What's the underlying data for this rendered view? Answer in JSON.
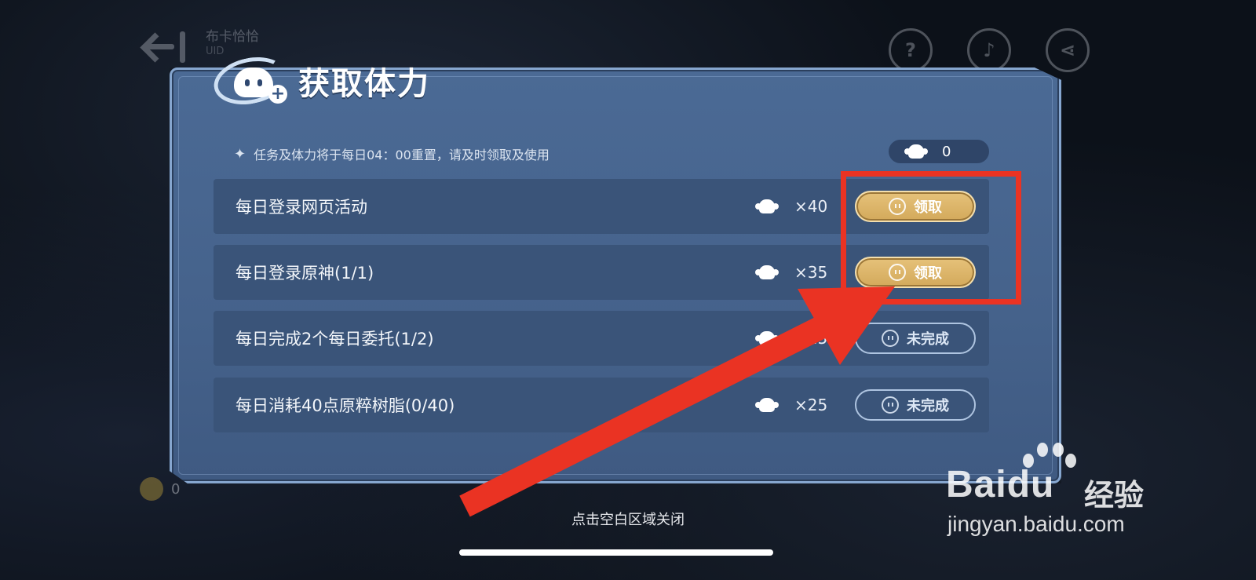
{
  "background": {
    "username": "布卡恰恰",
    "uid": "UID",
    "header_icons": [
      "help-icon",
      "music-icon",
      "share-icon"
    ],
    "counter_value": "0"
  },
  "dialog": {
    "title": "获取体力",
    "notice": "任务及体力将于每日04：00重置，请及时领取及使用",
    "stamina_count": "0",
    "tasks": [
      {
        "label": "每日登录网页活动",
        "reward": "×40",
        "button": "领取",
        "state": "claimable"
      },
      {
        "label": "每日登录原神(1/1)",
        "reward": "×35",
        "button": "领取",
        "state": "claimable"
      },
      {
        "label": "每日完成2个每日委托(1/2)",
        "reward": "×25",
        "button": "未完成",
        "state": "incomplete"
      },
      {
        "label": "每日消耗40点原粹树脂(0/40)",
        "reward": "×25",
        "button": "未完成",
        "state": "incomplete"
      }
    ]
  },
  "close_hint": "点击空白区域关闭",
  "annotation": {
    "color": "#ea3323"
  },
  "watermark": {
    "brand": "Bai",
    "brand_du": "du",
    "sub": "经验",
    "url": "jingyan.baidu.com"
  },
  "colors": {
    "panel": "#45628b",
    "row": "#3a5479",
    "claim_button": "#d3a95b",
    "incomplete_border": "#aec4e0"
  }
}
